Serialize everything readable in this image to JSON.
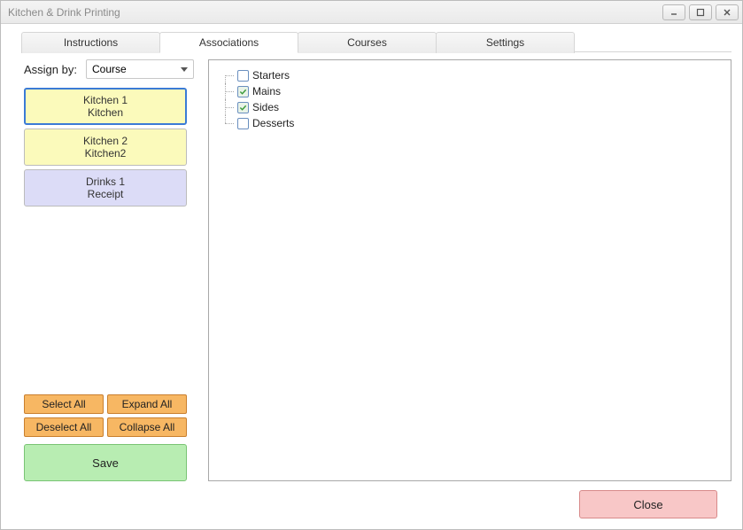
{
  "window": {
    "title": "Kitchen & Drink Printing"
  },
  "tabs": [
    {
      "label": "Instructions",
      "active": false
    },
    {
      "label": "Associations",
      "active": true
    },
    {
      "label": "Courses",
      "active": false
    },
    {
      "label": "Settings",
      "active": false
    }
  ],
  "assign": {
    "label": "Assign by:",
    "value": "Course"
  },
  "printers": [
    {
      "name": "Kitchen 1",
      "sub": "Kitchen",
      "color": "yellow",
      "selected": true
    },
    {
      "name": "Kitchen 2",
      "sub": "Kitchen2",
      "color": "yellow",
      "selected": false
    },
    {
      "name": "Drinks 1",
      "sub": "Receipt",
      "color": "lavender",
      "selected": false
    }
  ],
  "actions": {
    "select_all": "Select All",
    "expand_all": "Expand All",
    "deselect_all": "Deselect All",
    "collapse_all": "Collapse All",
    "save": "Save"
  },
  "tree": [
    {
      "label": "Starters",
      "checked": false
    },
    {
      "label": "Mains",
      "checked": true
    },
    {
      "label": "Sides",
      "checked": true
    },
    {
      "label": "Desserts",
      "checked": false
    }
  ],
  "footer": {
    "close": "Close"
  }
}
